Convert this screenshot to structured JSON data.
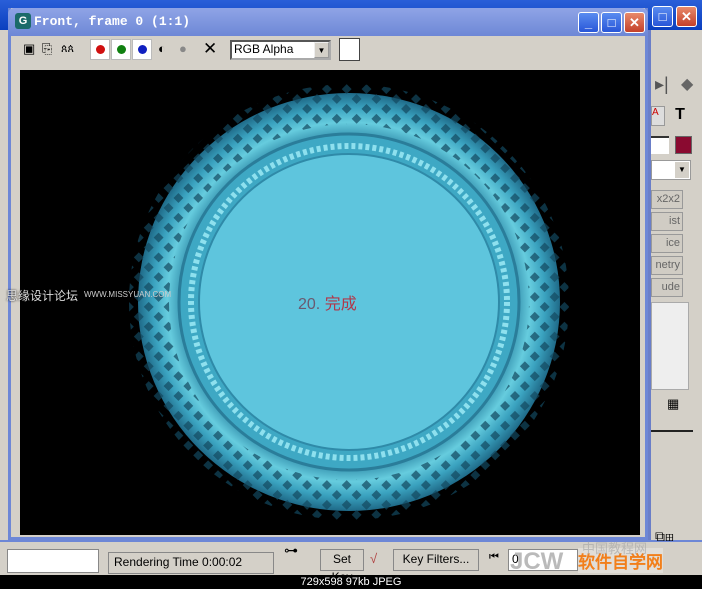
{
  "window": {
    "title": "Front, frame 0 (1:1)",
    "app_icon": "3dsmax-icon"
  },
  "toolbar": {
    "channel_select": "RGB Alpha",
    "icons": [
      "save-icon",
      "copy-icon",
      "clone-icon",
      "red-channel",
      "green-channel",
      "blue-channel",
      "mono-icon",
      "alpha-icon",
      "clear-icon"
    ]
  },
  "colors": {
    "red": "#d01010",
    "green": "#108010",
    "blue": "#1020c0",
    "plate": "#5ec5dd",
    "material_swatch": "#8a0a30"
  },
  "render": {
    "label_num": "20.",
    "label_text": "完成",
    "watermark_cn": "思缘设计论坛",
    "watermark_url": "WWW.MISSYUAN.COM"
  },
  "right_panel": {
    "buttons": [
      "x2x2",
      "ist",
      "ice",
      "netry",
      "ude"
    ]
  },
  "status": {
    "rendering_time": "Rendering Time  0:00:02",
    "set_key": "Set Key",
    "key_filters": "Key Filters...",
    "frame": "0"
  },
  "caption": "729x598  97kb  JPEG",
  "watermark_bottom": {
    "jcw": "JCW",
    "site": "软件自学网",
    "cn": "中国教程网"
  }
}
